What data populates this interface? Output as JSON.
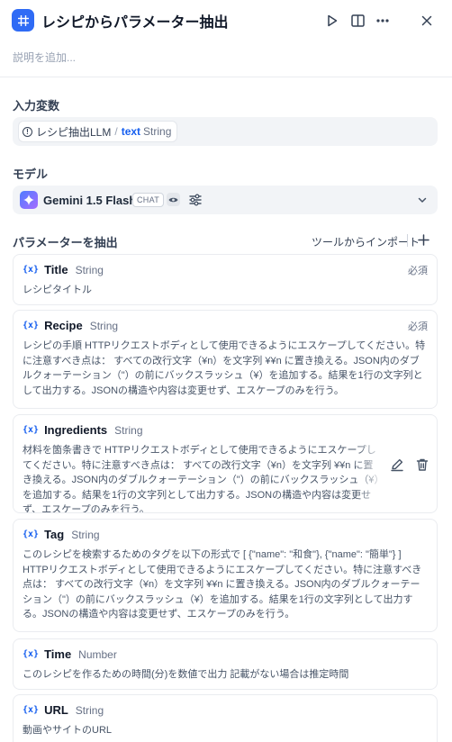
{
  "header": {
    "title": "レシピからパラメーター抽出",
    "description_placeholder": "説明を追加..."
  },
  "input": {
    "label": "入力変数",
    "node": "レシピ抽出LLM",
    "separator": "/",
    "var_name": "text",
    "var_type": "String"
  },
  "model": {
    "label": "モデル",
    "name": "Gemini 1.5 Flash",
    "badge": "CHAT"
  },
  "params": {
    "label": "パラメーターを抽出",
    "import_label": "ツールからインポート",
    "items": [
      {
        "icon_text": "{x}",
        "name": "Title",
        "type": "String",
        "required": "必須",
        "description": "レシピタイトル"
      },
      {
        "icon_text": "{x}",
        "name": "Recipe",
        "type": "String",
        "required": "必須",
        "description": "レシピの手順 HTTPリクエストボディとして使用できるようにエスケープしてください。特に注意すべき点は： すべての改行文字（¥n）を文字列 ¥¥n に置き換える。JSON内のダブルクォーテーション（\"）の前にバックスラッシュ（¥）を追加する。結果を1行の文字列として出力する。JSONの構造や内容は変更せず、エスケープのみを行う。"
      },
      {
        "icon_text": "{x}",
        "name": "Ingredients",
        "type": "String",
        "required": "",
        "description": "材料を箇条書きで HTTPリクエストボディとして使用できるようにエスケープしてください。特に注意すべき点は： すべての改行文字（¥n）を文字列 ¥¥n に置き換える。JSON内のダブルクォーテーション（\"）の前にバックスラッシュ（¥）を追加する。結果を1行の文字列として出力する。JSONの構造や内容は変更せず、エスケープのみを行う。"
      },
      {
        "icon_text": "{x}",
        "name": "Tag",
        "type": "String",
        "required": "",
        "description": "このレシピを検索するためのタグを以下の形式で [ {\"name\": \"和食\"}, {\"name\": \"簡単\"} ] HTTPリクエストボディとして使用できるようにエスケープしてください。特に注意すべき点は： すべての改行文字（¥n）を文字列 ¥¥n に置き換える。JSON内のダブルクォーテーション（\"）の前にバックスラッシュ（¥）を追加する。結果を1行の文字列として出力する。JSONの構造や内容は変更せず、エスケープのみを行う。"
      },
      {
        "icon_text": "{x}",
        "name": "Time",
        "type": "Number",
        "required": "",
        "description": "このレシピを作るための時間(分)を数値で出力 記載がない場合は推定時間"
      },
      {
        "icon_text": "{x}",
        "name": "URL",
        "type": "String",
        "required": "",
        "description": "動画やサイトのURL"
      }
    ]
  },
  "icons": {
    "app": "grid-icon",
    "run": "play-icon",
    "panel": "split-panel-icon",
    "more": "more-icon",
    "close": "close-icon",
    "edit": "pencil-icon",
    "delete": "trash-icon"
  },
  "colors": {
    "accent": "#155eef",
    "app_icon": "#2f6bf5"
  }
}
